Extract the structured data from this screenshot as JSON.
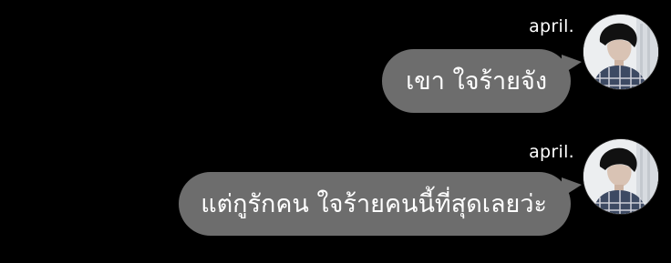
{
  "messages": [
    {
      "sender": "april.",
      "text": "เขา ใจร้ายจัง"
    },
    {
      "sender": "april.",
      "text": "แต่กูรักคน ใจร้ายคนนี้ที่สุดเลยว่ะ"
    }
  ],
  "colors": {
    "background": "#000000",
    "bubble": "#6d6d6d",
    "text": "#ffffff"
  }
}
